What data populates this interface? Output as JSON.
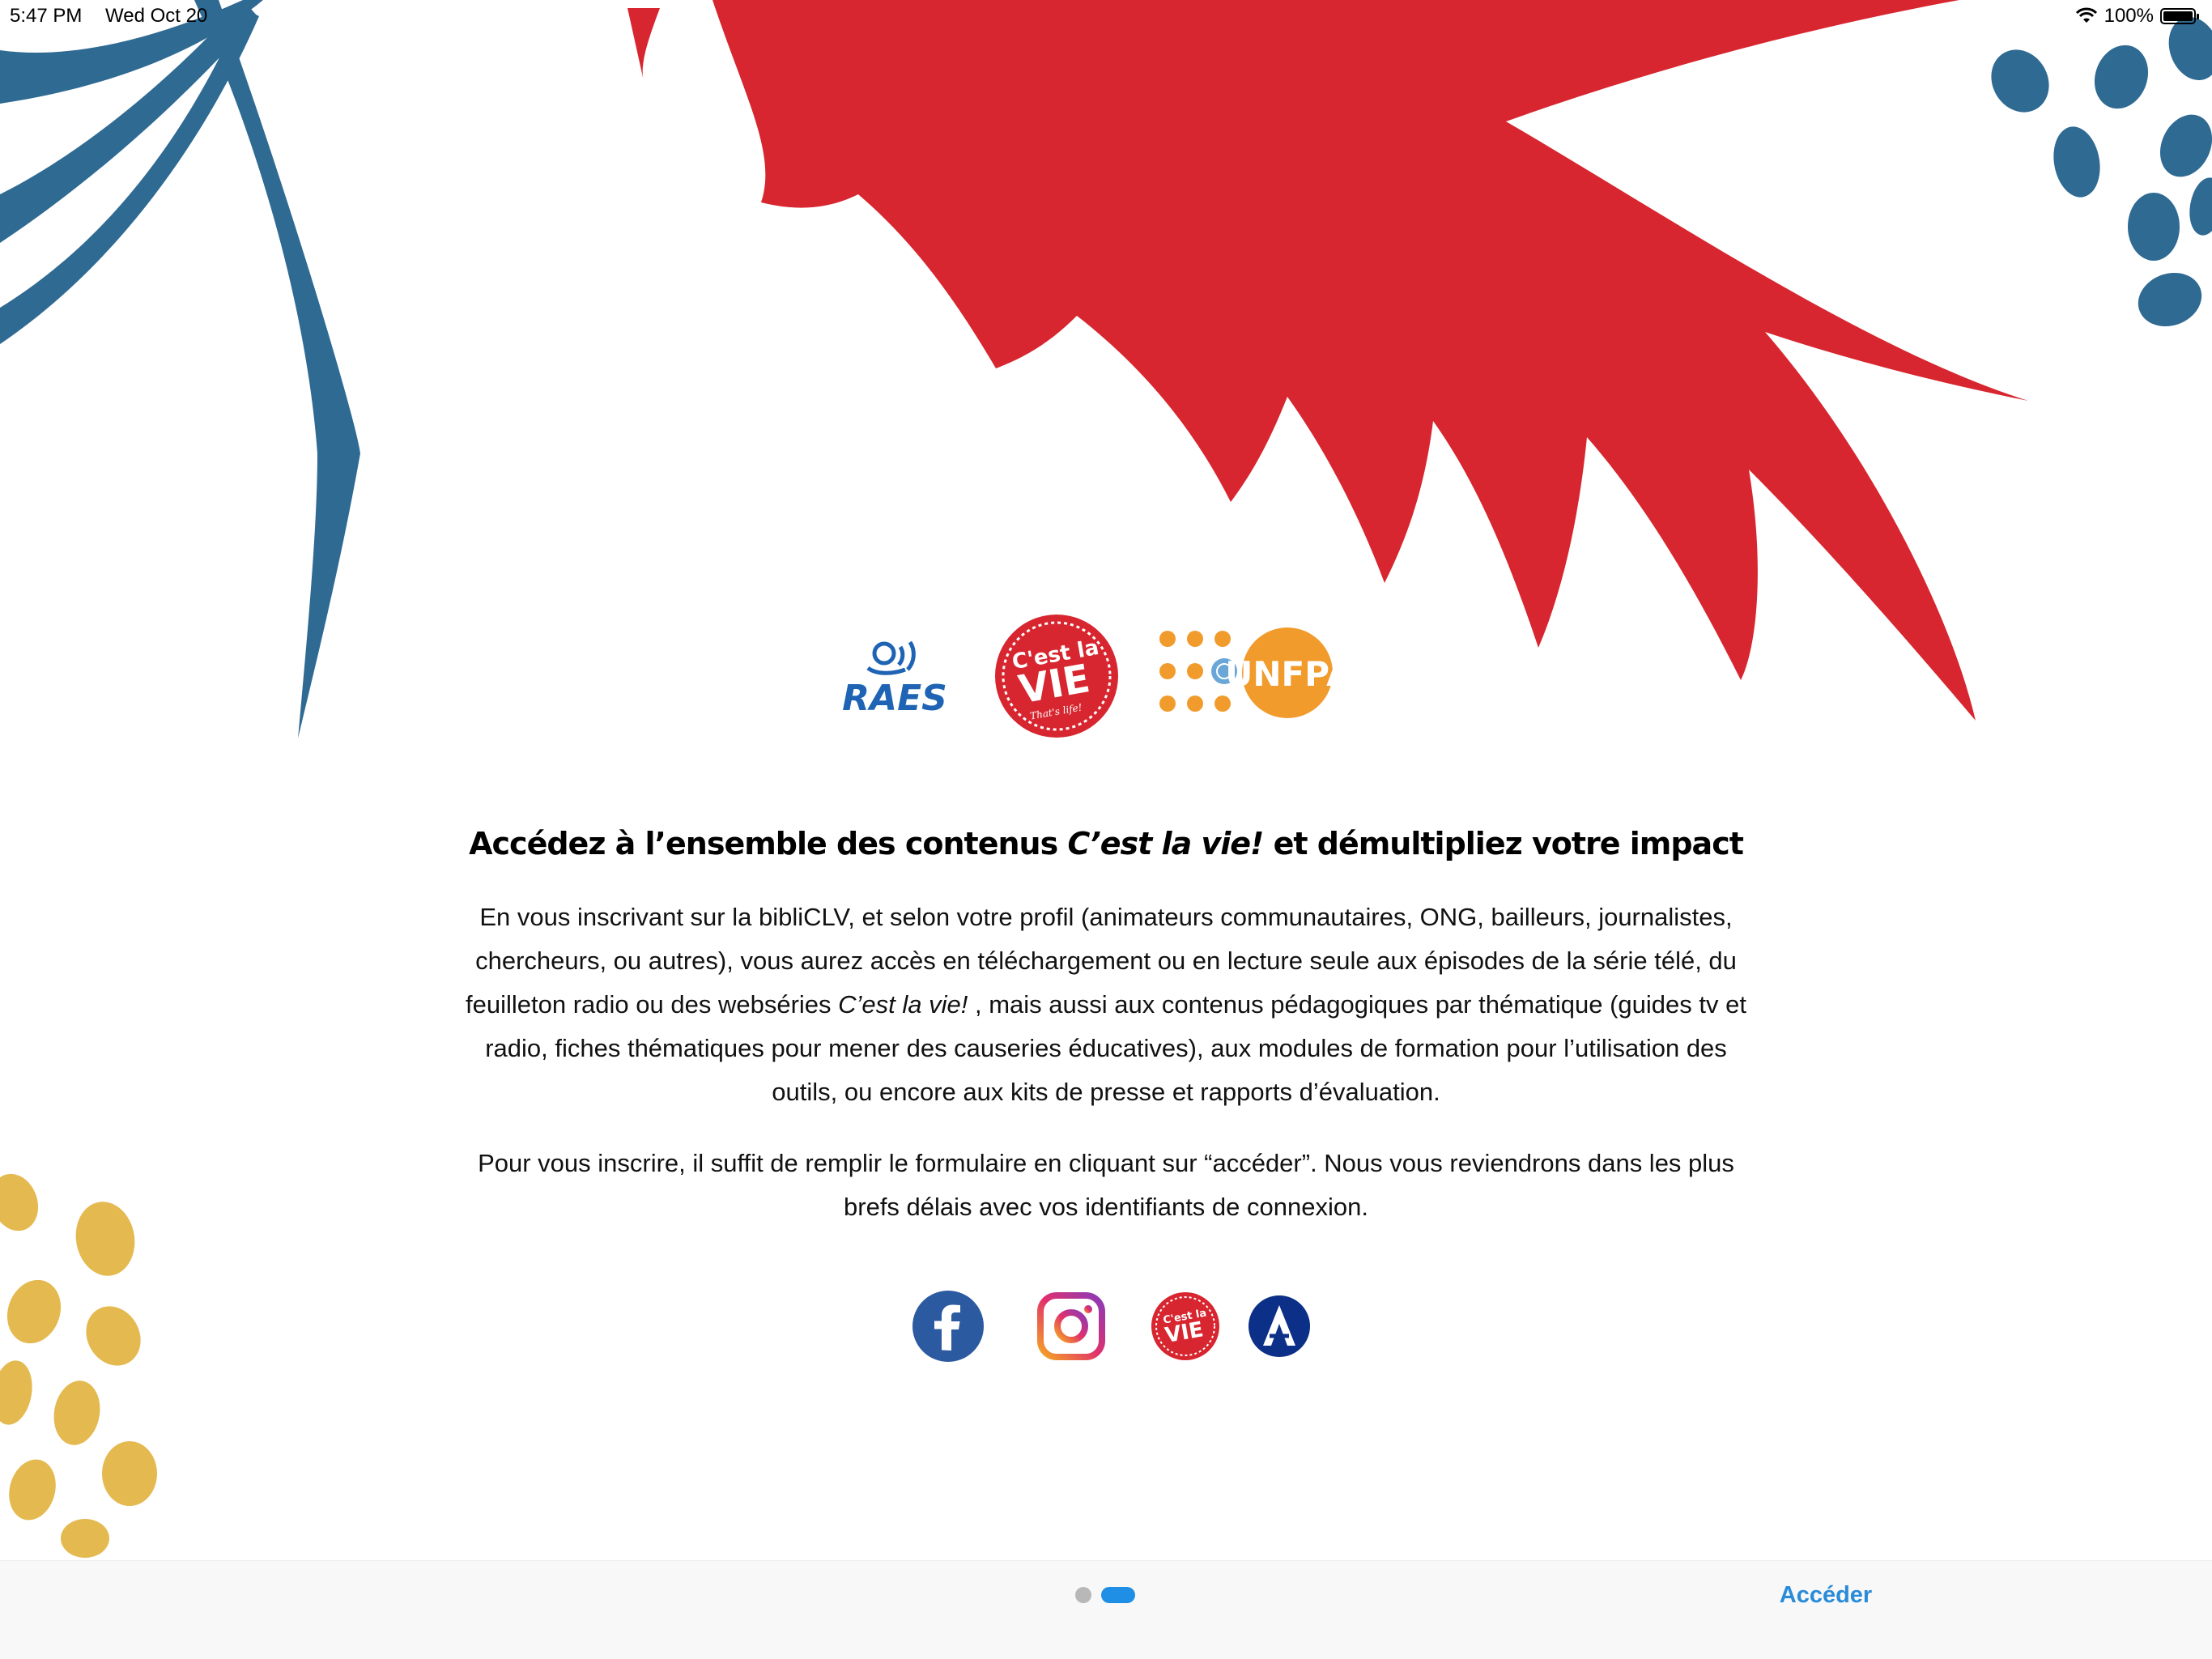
{
  "status_bar": {
    "time": "5:47 PM",
    "date": "Wed Oct 20",
    "battery": "100%",
    "battery_level": 1.0
  },
  "partners": {
    "raes": "RAES",
    "clv_line1": "C'est la",
    "clv_line2": "VIE",
    "clv_tagline": "That's life!",
    "unfpa": "UNFPA"
  },
  "main": {
    "headline_pre": "Accédez à l’ensemble des contenus ",
    "headline_brand": "C’est la vie!",
    "headline_post": " et démultipliez votre impact",
    "p1_a": "En vous inscrivant sur la bibliCLV, et selon votre profil (animateurs communautaires, ONG, bailleurs, journalistes, chercheurs, ou autres), vous aurez accès en téléchargement ou en lecture seule aux épisodes de la série télé, du feuilleton radio ou des webséries ",
    "p1_brand": "C’est la vie!",
    "p1_b": " , mais aussi aux contenus pédagogiques par thématique (guides tv et radio, fiches thématiques pour mener des causeries éducatives), aux modules de formation pour l’utilisation des outils, ou encore aux kits de presse et rapports d’évaluation.",
    "p2": "Pour vous inscrire, il suffit de remplir le formulaire en cliquant sur “accéder”. Nous vous reviendrons dans les plus brefs délais avec vos identifiants de connexion."
  },
  "footer": {
    "button_label": "Accéder",
    "page_index": 2,
    "page_count": 2
  },
  "colors": {
    "red": "#d7262f",
    "blue": "#2f6a93",
    "yellow": "#e4b94f",
    "orange": "#f19b2c",
    "accent": "#2a8bd8"
  }
}
